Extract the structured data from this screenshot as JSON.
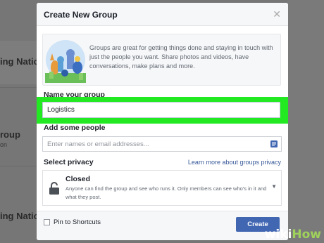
{
  "background": {
    "rows": [
      {
        "title": "ing Nation",
        "sub": ""
      },
      {
        "title": "roup",
        "sub": "on"
      },
      {
        "title": "ing Nation",
        "sub": ""
      }
    ]
  },
  "dialog": {
    "title": "Create New Group",
    "close_icon": "close-icon",
    "intro_text": "Groups are great for getting things done and staying in touch with just the people you want. Share photos and videos, have conversations, make plans and more.",
    "name_label": "Name your group",
    "name_value": "Logistics",
    "people_label": "Add some people",
    "people_placeholder": "Enter names or email addresses...",
    "privacy_label": "Select privacy",
    "privacy_link": "Learn more about groups privacy",
    "privacy_option_title": "Closed",
    "privacy_option_desc": "Anyone can find the group and see who runs it. Only members can see who's in it and what they post.",
    "pin_label": "Pin to Shortcuts",
    "create_label": "Create"
  },
  "watermark": {
    "wiki": "wiki",
    "how": "How"
  },
  "colors": {
    "highlight": "#22e922",
    "button": "#4267b2",
    "link": "#365899"
  }
}
